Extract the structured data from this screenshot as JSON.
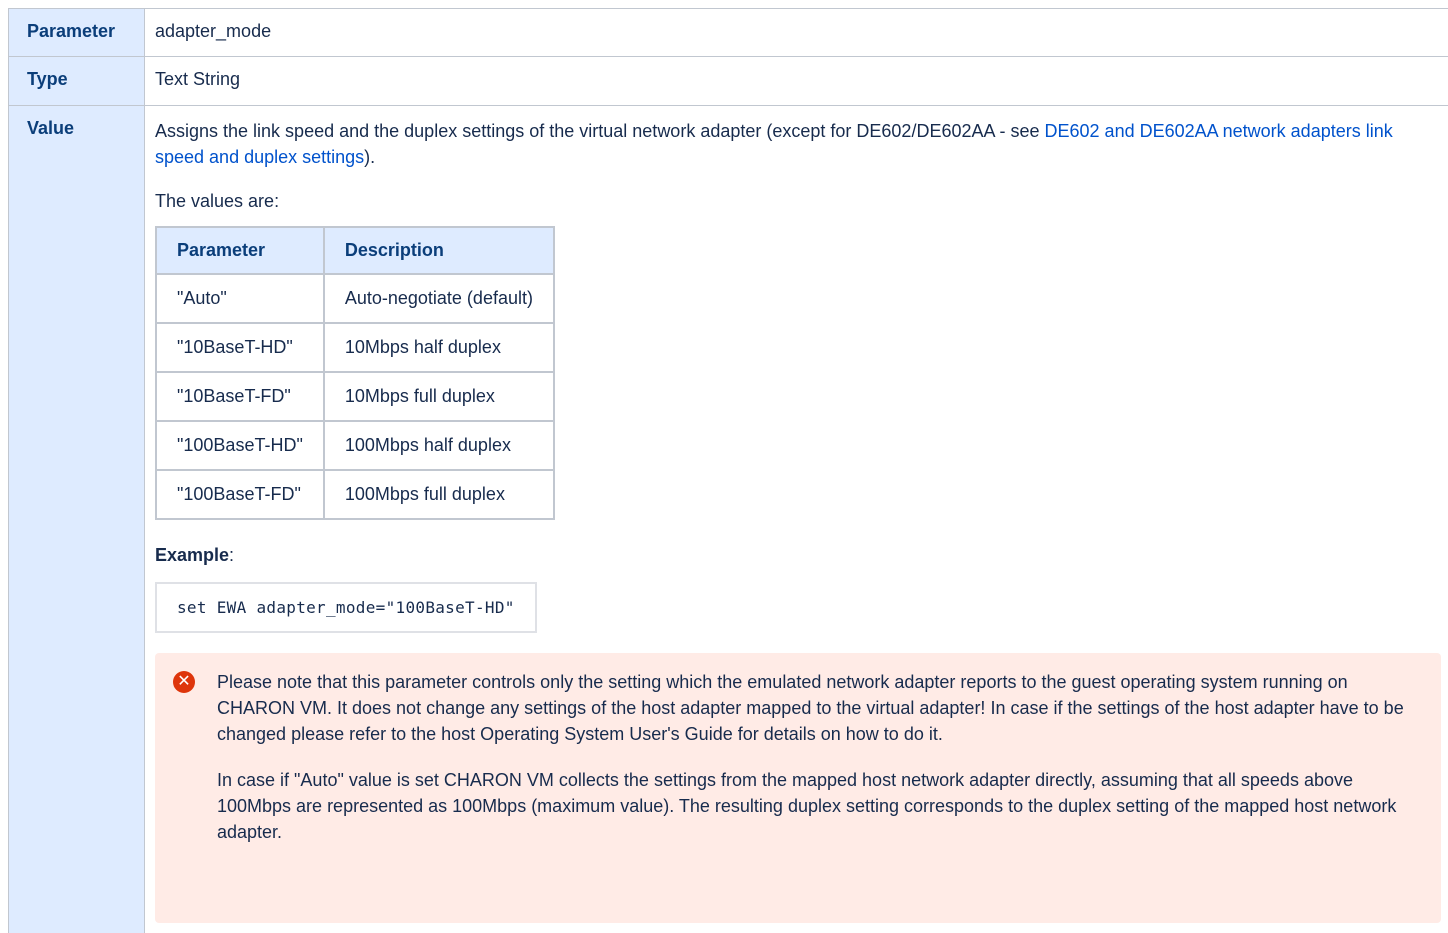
{
  "rows": {
    "parameter": {
      "label": "Parameter",
      "value": "adapter_mode"
    },
    "type": {
      "label": "Type",
      "value": "Text String"
    },
    "value": {
      "label": "Value",
      "description_before": "Assigns the link speed and the duplex settings of the virtual network adapter (except for DE602/DE602AA - see ",
      "description_link": "DE602 and DE602AA network adapters link speed and duplex settings",
      "description_after": ").",
      "values_intro": "The values are:",
      "values_table": {
        "headers": [
          "Parameter",
          "Description"
        ],
        "rows": [
          [
            "\"Auto\"",
            "Auto-negotiate (default)"
          ],
          [
            "\"10BaseT-HD\"",
            "10Mbps half duplex"
          ],
          [
            "\"10BaseT-FD\"",
            "10Mbps full duplex"
          ],
          [
            "\"100BaseT-HD\"",
            "100Mbps half duplex"
          ],
          [
            "\"100BaseT-FD\"",
            "100Mbps full duplex"
          ]
        ]
      },
      "example_label": "Example",
      "example_suffix": ":",
      "example_code": "set EWA adapter_mode=\"100BaseT-HD\"",
      "warning": {
        "icon": "error-icon",
        "color": "#de350b",
        "paragraph1": "Please note that this parameter controls only the setting which the emulated network adapter reports to the guest operating system running on CHARON VM. It does not change any settings of the host adapter mapped to the virtual adapter! In case if the settings of the host adapter have to be changed please refer to the host Operating System User's Guide for details on how to do it.",
        "paragraph2": "In case if \"Auto\" value is set CHARON VM collects the settings from the mapped host network adapter directly, assuming that all speeds above 100Mbps are represented as 100Mbps (maximum value). The resulting duplex setting corresponds to the duplex setting of the mapped host network adapter."
      }
    }
  },
  "colors": {
    "header_bg": "#deebff",
    "header_text": "#0b3e7a",
    "link": "#0052cc",
    "warning_bg": "#ffebe6",
    "border": "#c1c7d0"
  }
}
